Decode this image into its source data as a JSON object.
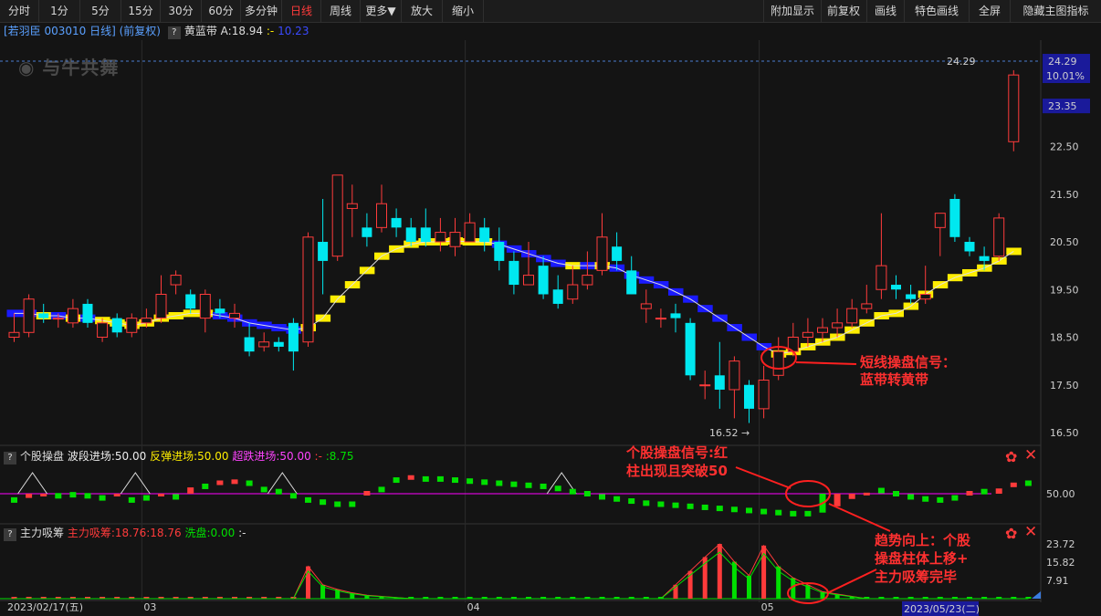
{
  "toolbar": {
    "left": [
      "分时",
      "1分",
      "5分",
      "15分",
      "30分",
      "60分",
      "多分钟",
      "日线",
      "周线",
      "更多▼",
      "放大",
      "缩小"
    ],
    "active": "日线",
    "right": [
      "附加显示",
      "前复权",
      "画线",
      "特色画线",
      "全屏",
      "隐藏主图指标"
    ]
  },
  "main_info": {
    "stock": "[若羽臣 003010 日线] (前复权)",
    "indicator": "黄蓝带",
    "a_label": "A:18.94",
    "sep": ":-",
    "b_value": "10.23"
  },
  "logo_text": "与牛共舞",
  "price_axis": {
    "ticks": [
      "24.29",
      "23.35",
      "22.50",
      "21.50",
      "20.50",
      "19.50",
      "18.50",
      "17.50",
      "16.50"
    ],
    "tick_values": [
      24.29,
      23.35,
      22.5,
      21.5,
      20.5,
      19.5,
      18.5,
      17.5,
      16.5
    ],
    "pct": "10.01%",
    "high_label": "24.29",
    "low_label": "16.52"
  },
  "panel2_info": {
    "name": "个股操盘",
    "wave": "波段进场:50.00",
    "rebound": "反弹进场:50.00",
    "oversold": "超跌进场:50.00",
    "sep": ":-",
    "value": ":8.75",
    "axis_tick": "50.00"
  },
  "panel3_info": {
    "name": "主力吸筹",
    "label1": "主力吸筹:18.76",
    "label2": ":18.76",
    "label3": "洗盘:0.00",
    "sep": ":-",
    "axis_ticks": [
      "23.72",
      "15.82",
      "7.91"
    ]
  },
  "date_axis": {
    "start": "2023/02/17(五)",
    "labels": [
      "03",
      "04",
      "05"
    ],
    "end": "2023/05/23(二)"
  },
  "annotations": {
    "a1": [
      "短线操盘信号：",
      "蓝带转黄带"
    ],
    "a2": [
      "个股操盘信号:红",
      "柱出现且突破50"
    ],
    "a3": [
      "趋势向上：个股",
      "操盘柱体上移+",
      "主力吸筹完毕"
    ]
  },
  "colors": {
    "up": "#ff3b3b",
    "down": "#00e8f0",
    "yellow": "#ffee00",
    "blue": "#1a1aff",
    "green": "#00e000",
    "magenta": "#ff00ff"
  },
  "chart_data": {
    "type": "candlestick",
    "ylim": [
      16.3,
      24.6
    ],
    "x_labels": {
      "0": "2023/02/17(五)",
      "9": "03",
      "31": "04",
      "51": "05",
      "62": "2023/05/23(二)"
    },
    "candles": [
      [
        18.5,
        18.6,
        19.0,
        18.4
      ],
      [
        18.6,
        19.3,
        19.4,
        18.5
      ],
      [
        19.0,
        18.9,
        19.2,
        18.8
      ],
      [
        18.9,
        18.9,
        19.0,
        18.7
      ],
      [
        18.8,
        19.1,
        19.3,
        18.7
      ],
      [
        19.2,
        18.8,
        19.3,
        18.7
      ],
      [
        18.5,
        18.8,
        18.9,
        18.4
      ],
      [
        18.9,
        18.6,
        19.0,
        18.5
      ],
      [
        18.6,
        18.9,
        19.0,
        18.5
      ],
      [
        18.8,
        18.9,
        19.1,
        18.7
      ],
      [
        18.9,
        19.4,
        19.8,
        18.8
      ],
      [
        19.6,
        19.8,
        19.9,
        19.4
      ],
      [
        19.4,
        19.1,
        19.5,
        19.0
      ],
      [
        18.9,
        19.4,
        19.5,
        18.6
      ],
      [
        19.1,
        19.0,
        19.3,
        18.9
      ],
      [
        18.9,
        19.0,
        19.2,
        18.7
      ],
      [
        18.5,
        18.2,
        18.8,
        18.1
      ],
      [
        18.3,
        18.4,
        18.6,
        18.2
      ],
      [
        18.4,
        18.3,
        18.5,
        18.2
      ],
      [
        18.8,
        18.2,
        18.9,
        17.8
      ],
      [
        18.4,
        20.6,
        20.7,
        18.3
      ],
      [
        20.5,
        20.1,
        21.4,
        19.4
      ],
      [
        20.2,
        21.9,
        21.9,
        20.1
      ],
      [
        21.2,
        21.3,
        21.7,
        20.6
      ],
      [
        20.8,
        20.6,
        21.1,
        20.4
      ],
      [
        20.8,
        21.3,
        21.7,
        20.7
      ],
      [
        21.0,
        20.8,
        21.2,
        20.6
      ],
      [
        20.8,
        20.5,
        21.0,
        20.4
      ],
      [
        20.8,
        20.5,
        21.2,
        20.4
      ],
      [
        20.5,
        20.7,
        21.0,
        20.3
      ],
      [
        20.4,
        20.7,
        21.0,
        20.2
      ],
      [
        20.5,
        20.9,
        21.1,
        20.5
      ],
      [
        20.8,
        20.5,
        21.0,
        20.3
      ],
      [
        20.5,
        20.1,
        20.8,
        19.9
      ],
      [
        20.1,
        19.6,
        20.3,
        19.4
      ],
      [
        19.6,
        19.8,
        20.5,
        19.6
      ],
      [
        20.0,
        19.4,
        20.2,
        19.3
      ],
      [
        19.5,
        19.2,
        19.8,
        19.1
      ],
      [
        19.3,
        19.6,
        20.0,
        19.2
      ],
      [
        19.6,
        19.8,
        20.3,
        19.5
      ],
      [
        19.9,
        20.6,
        21.1,
        19.8
      ],
      [
        20.4,
        20.1,
        20.7,
        19.9
      ],
      [
        19.9,
        19.4,
        20.2,
        19.4
      ],
      [
        19.1,
        19.2,
        19.5,
        18.8
      ],
      [
        18.9,
        18.9,
        19.1,
        18.7
      ],
      [
        19.0,
        18.9,
        19.2,
        18.6
      ],
      [
        18.8,
        17.7,
        18.9,
        17.6
      ],
      [
        17.5,
        17.5,
        17.8,
        17.2
      ],
      [
        17.7,
        17.4,
        18.4,
        17.0
      ],
      [
        17.4,
        18.0,
        18.1,
        16.8
      ],
      [
        17.5,
        17.0,
        17.6,
        16.7
      ],
      [
        17.0,
        17.6,
        17.9,
        16.8
      ],
      [
        17.7,
        18.2,
        18.5,
        17.6
      ],
      [
        18.2,
        18.5,
        18.8,
        18.1
      ],
      [
        18.5,
        18.6,
        18.9,
        18.3
      ],
      [
        18.6,
        18.7,
        18.9,
        18.4
      ],
      [
        18.7,
        18.8,
        19.1,
        18.5
      ],
      [
        18.8,
        19.1,
        19.3,
        18.7
      ],
      [
        19.1,
        19.2,
        19.6,
        19.0
      ],
      [
        19.5,
        20.0,
        21.1,
        19.3
      ],
      [
        19.6,
        19.5,
        19.8,
        19.3
      ],
      [
        19.4,
        19.3,
        19.6,
        19.2
      ],
      [
        19.3,
        19.4,
        20.0,
        19.2
      ],
      [
        20.8,
        21.1,
        21.1,
        20.2
      ],
      [
        21.4,
        20.6,
        21.5,
        20.5
      ],
      [
        20.5,
        20.3,
        20.6,
        20.2
      ],
      [
        20.2,
        20.1,
        20.4,
        19.9
      ],
      [
        20.2,
        21.0,
        21.1,
        20.1
      ],
      [
        22.6,
        24.0,
        24.1,
        22.4
      ]
    ],
    "band": [
      [
        19.0,
        "b"
      ],
      [
        19.0,
        "b"
      ],
      [
        18.95,
        "y"
      ],
      [
        18.95,
        "b"
      ],
      [
        18.9,
        "y"
      ],
      [
        18.9,
        "b"
      ],
      [
        18.85,
        "y"
      ],
      [
        18.8,
        "y"
      ],
      [
        18.75,
        "y"
      ],
      [
        18.8,
        "y"
      ],
      [
        18.9,
        "y"
      ],
      [
        18.95,
        "y"
      ],
      [
        19.0,
        "y"
      ],
      [
        19.0,
        "y"
      ],
      [
        18.95,
        "b"
      ],
      [
        18.9,
        "b"
      ],
      [
        18.8,
        "b"
      ],
      [
        18.75,
        "b"
      ],
      [
        18.7,
        "b"
      ],
      [
        18.65,
        "b"
      ],
      [
        18.7,
        "y"
      ],
      [
        18.9,
        "y"
      ],
      [
        19.3,
        "y"
      ],
      [
        19.6,
        "y"
      ],
      [
        19.9,
        "y"
      ],
      [
        20.2,
        "y"
      ],
      [
        20.35,
        "y"
      ],
      [
        20.45,
        "y"
      ],
      [
        20.5,
        "y"
      ],
      [
        20.5,
        "y"
      ],
      [
        20.52,
        "y"
      ],
      [
        20.5,
        "y"
      ],
      [
        20.5,
        "y"
      ],
      [
        20.45,
        "b"
      ],
      [
        20.35,
        "b"
      ],
      [
        20.25,
        "b"
      ],
      [
        20.15,
        "b"
      ],
      [
        20.05,
        "b"
      ],
      [
        20.0,
        "y"
      ],
      [
        20.0,
        "b"
      ],
      [
        20.0,
        "y"
      ],
      [
        19.95,
        "b"
      ],
      [
        19.8,
        "b"
      ],
      [
        19.7,
        "b"
      ],
      [
        19.6,
        "b"
      ],
      [
        19.45,
        "b"
      ],
      [
        19.3,
        "b"
      ],
      [
        19.1,
        "b"
      ],
      [
        18.9,
        "b"
      ],
      [
        18.7,
        "b"
      ],
      [
        18.5,
        "b"
      ],
      [
        18.3,
        "b"
      ],
      [
        18.15,
        "y"
      ],
      [
        18.2,
        "y"
      ],
      [
        18.3,
        "y"
      ],
      [
        18.4,
        "y"
      ],
      [
        18.5,
        "y"
      ],
      [
        18.65,
        "y"
      ],
      [
        18.8,
        "y"
      ],
      [
        18.95,
        "y"
      ],
      [
        19.0,
        "y"
      ],
      [
        19.15,
        "y"
      ],
      [
        19.4,
        "y"
      ],
      [
        19.6,
        "y"
      ],
      [
        19.75,
        "y"
      ],
      [
        19.85,
        "y"
      ],
      [
        19.95,
        "y"
      ],
      [
        20.1,
        "y"
      ],
      [
        20.3,
        "y"
      ]
    ],
    "panel2": [
      [
        44,
        "g"
      ],
      [
        46,
        "r"
      ],
      [
        48,
        "r"
      ],
      [
        48,
        "g"
      ],
      [
        49,
        "g"
      ],
      [
        48,
        "g"
      ],
      [
        46,
        "g"
      ],
      [
        48,
        "r"
      ],
      [
        44,
        "g"
      ],
      [
        46,
        "g"
      ],
      [
        48,
        "r"
      ],
      [
        47,
        "g"
      ],
      [
        56,
        "r"
      ],
      [
        57,
        "g"
      ],
      [
        60,
        "r"
      ],
      [
        61,
        "r"
      ],
      [
        60,
        "g"
      ],
      [
        54,
        "g"
      ],
      [
        52,
        "g"
      ],
      [
        48,
        "g"
      ],
      [
        44,
        "g"
      ],
      [
        42,
        "g"
      ],
      [
        40,
        "g"
      ],
      [
        40,
        "g"
      ],
      [
        50,
        "r"
      ],
      [
        54,
        "g"
      ],
      [
        63,
        "g"
      ],
      [
        65,
        "r"
      ],
      [
        64,
        "g"
      ],
      [
        64,
        "g"
      ],
      [
        63,
        "g"
      ],
      [
        62,
        "g"
      ],
      [
        61,
        "g"
      ],
      [
        60,
        "g"
      ],
      [
        59,
        "g"
      ],
      [
        58,
        "g"
      ],
      [
        57,
        "g"
      ],
      [
        55,
        "g"
      ],
      [
        52,
        "g"
      ],
      [
        50,
        "g"
      ],
      [
        47,
        "g"
      ],
      [
        45,
        "g"
      ],
      [
        43,
        "g"
      ],
      [
        41,
        "g"
      ],
      [
        40,
        "g"
      ],
      [
        39,
        "g"
      ],
      [
        38,
        "g"
      ],
      [
        37,
        "g"
      ],
      [
        36,
        "g"
      ],
      [
        35,
        "g"
      ],
      [
        34,
        "g"
      ],
      [
        33,
        "g"
      ],
      [
        32,
        "g"
      ],
      [
        31,
        "g"
      ],
      [
        31,
        "g"
      ],
      [
        32,
        "g"
      ],
      [
        38,
        "r"
      ],
      [
        45,
        "r"
      ],
      [
        51,
        "r"
      ],
      [
        53,
        "g"
      ],
      [
        50,
        "g"
      ],
      [
        47,
        "g"
      ],
      [
        45,
        "g"
      ],
      [
        44,
        "g"
      ],
      [
        46,
        "g"
      ],
      [
        50,
        "r"
      ],
      [
        52,
        "g"
      ],
      [
        55,
        "r"
      ],
      [
        58,
        "r"
      ],
      [
        60,
        "g"
      ]
    ],
    "panel3": [
      [
        0,
        "r"
      ],
      [
        0,
        "r"
      ],
      [
        0,
        "r"
      ],
      [
        0,
        "r"
      ],
      [
        0,
        "r"
      ],
      [
        0,
        "r"
      ],
      [
        0,
        "r"
      ],
      [
        0,
        "r"
      ],
      [
        0,
        "r"
      ],
      [
        0,
        "r"
      ],
      [
        0,
        "r"
      ],
      [
        0,
        "r"
      ],
      [
        0,
        "r"
      ],
      [
        0,
        "r"
      ],
      [
        0,
        "r"
      ],
      [
        0,
        "r"
      ],
      [
        0,
        "r"
      ],
      [
        0,
        "r"
      ],
      [
        0,
        "r"
      ],
      [
        0,
        "r"
      ],
      [
        14,
        "r"
      ],
      [
        6,
        "g"
      ],
      [
        4,
        "g"
      ],
      [
        2.5,
        "g"
      ],
      [
        1.5,
        "g"
      ],
      [
        1,
        "g"
      ],
      [
        0.5,
        "g"
      ],
      [
        0,
        "g"
      ],
      [
        0,
        "g"
      ],
      [
        0,
        "g"
      ],
      [
        0,
        "g"
      ],
      [
        0,
        "g"
      ],
      [
        0,
        "g"
      ],
      [
        0,
        "g"
      ],
      [
        0,
        "g"
      ],
      [
        0,
        "g"
      ],
      [
        0,
        "g"
      ],
      [
        0,
        "g"
      ],
      [
        0,
        "g"
      ],
      [
        0,
        "g"
      ],
      [
        0,
        "g"
      ],
      [
        0,
        "g"
      ],
      [
        0,
        "g"
      ],
      [
        0,
        "g"
      ],
      [
        0,
        "g"
      ],
      [
        6,
        "r"
      ],
      [
        12,
        "r"
      ],
      [
        18,
        "r"
      ],
      [
        23.7,
        "r"
      ],
      [
        16,
        "g"
      ],
      [
        10,
        "g"
      ],
      [
        23,
        "r"
      ],
      [
        14,
        "g"
      ],
      [
        9,
        "g"
      ],
      [
        6,
        "g"
      ],
      [
        3,
        "g"
      ],
      [
        2,
        "g"
      ],
      [
        1,
        "g"
      ],
      [
        0,
        "g"
      ],
      [
        0,
        "g"
      ],
      [
        0,
        "g"
      ],
      [
        0,
        "g"
      ],
      [
        0,
        "g"
      ],
      [
        0,
        "g"
      ],
      [
        0,
        "g"
      ],
      [
        0,
        "g"
      ],
      [
        0,
        "g"
      ],
      [
        0,
        "g"
      ],
      [
        0,
        "g"
      ],
      [
        0,
        "g"
      ]
    ]
  }
}
